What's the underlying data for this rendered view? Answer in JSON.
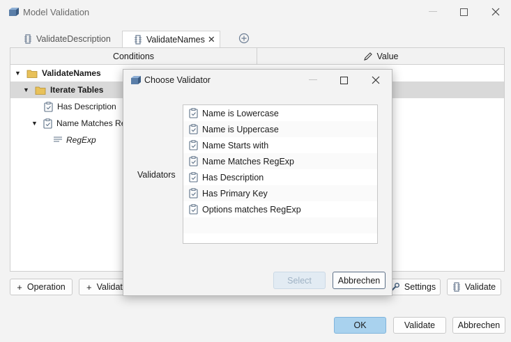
{
  "window": {
    "title": "Model Validation"
  },
  "tabs": [
    {
      "label": "ValidateDescription",
      "active": false
    },
    {
      "label": "ValidateNames",
      "active": true,
      "close": "✕"
    }
  ],
  "grid": {
    "col_conditions": "Conditions",
    "col_value": "Value",
    "rows": [
      {
        "label": "ValidateNames",
        "expander": "▼",
        "icon": "folder-icon"
      },
      {
        "label": "Iterate Tables",
        "expander": "▼",
        "icon": "folder-icon",
        "selected": true
      },
      {
        "label": "Has Description",
        "icon": "clipboard-check-icon"
      },
      {
        "label": "Name Matches Re",
        "expander": "▼",
        "icon": "clipboard-check-icon"
      },
      {
        "label": "RegExp",
        "icon": "text-lines-icon"
      }
    ]
  },
  "toolbar": {
    "operation": "Operation",
    "validator": "Validat",
    "settings": "Settings",
    "validate": "Validate"
  },
  "footer": {
    "ok": "OK",
    "validate": "Validate",
    "cancel": "Abbrechen"
  },
  "dialog": {
    "title": "Choose Validator",
    "label": "Validators",
    "items": [
      "Name is Lowercase",
      "Name is Uppercase",
      "Name Starts with",
      "Name Matches RegExp",
      "Has Description",
      "Has Primary Key",
      "Options matches RegExp"
    ],
    "select": "Select",
    "cancel": "Abbrechen"
  },
  "colors": {
    "accent_ok": "#a9d2ee",
    "selected_row": "#d9d9d9",
    "folder": "#e8c15a"
  }
}
